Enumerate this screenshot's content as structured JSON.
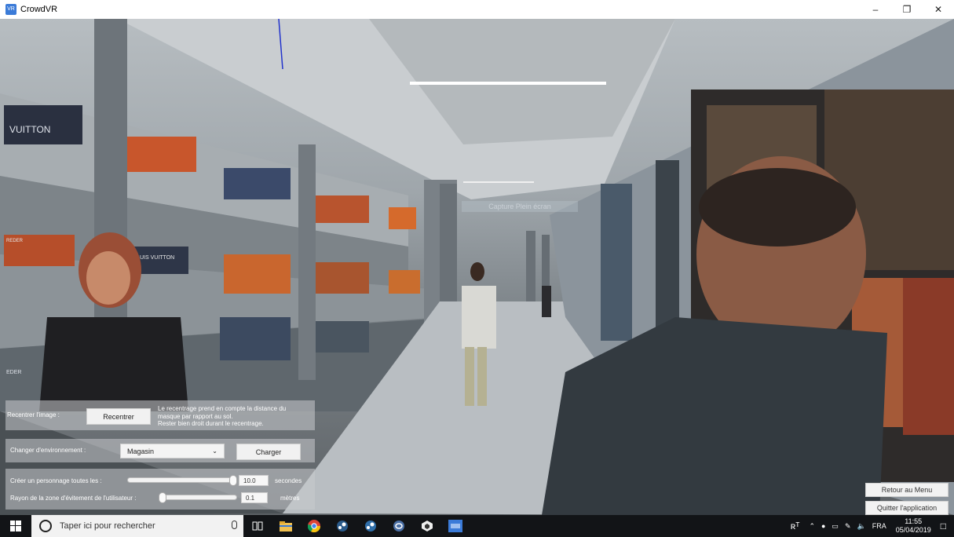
{
  "window": {
    "title": "CrowdVR",
    "app_icon_text": "VR"
  },
  "scene": {
    "overlay_hint": "Capture Plein écran",
    "store_signs": [
      "VUITTON",
      "UIS VUITTON",
      "REDER",
      "EDER"
    ]
  },
  "controls": {
    "recenter": {
      "label": "Recentrer l'image :",
      "button": "Recentrer",
      "note": "Le recentrage prend en compte la distance du\nmasque par rapport au sol.\nRester bien droit durant le recentrage."
    },
    "environment": {
      "label": "Changer d'environnement :",
      "selected": "Magasin",
      "button": "Charger"
    },
    "spawn": {
      "label": "Créer un personnage toutes les :",
      "value": "10.0",
      "unit": "secondes",
      "level": 1.0
    },
    "avoid": {
      "label": "Rayon de la zone d'évitement de l'utilisateur :",
      "value": "0.1",
      "unit": "mètres",
      "level": 0.0
    }
  },
  "side_buttons": {
    "menu": "Retour au Menu",
    "quit": "Quitter l'application"
  },
  "taskbar": {
    "search_placeholder": "Taper ici pour rechercher",
    "language": "FRA",
    "time": "11:55",
    "date": "05/04/2019"
  },
  "colors": {
    "accent": "#3b7bd8",
    "taskbar": "#121417"
  }
}
